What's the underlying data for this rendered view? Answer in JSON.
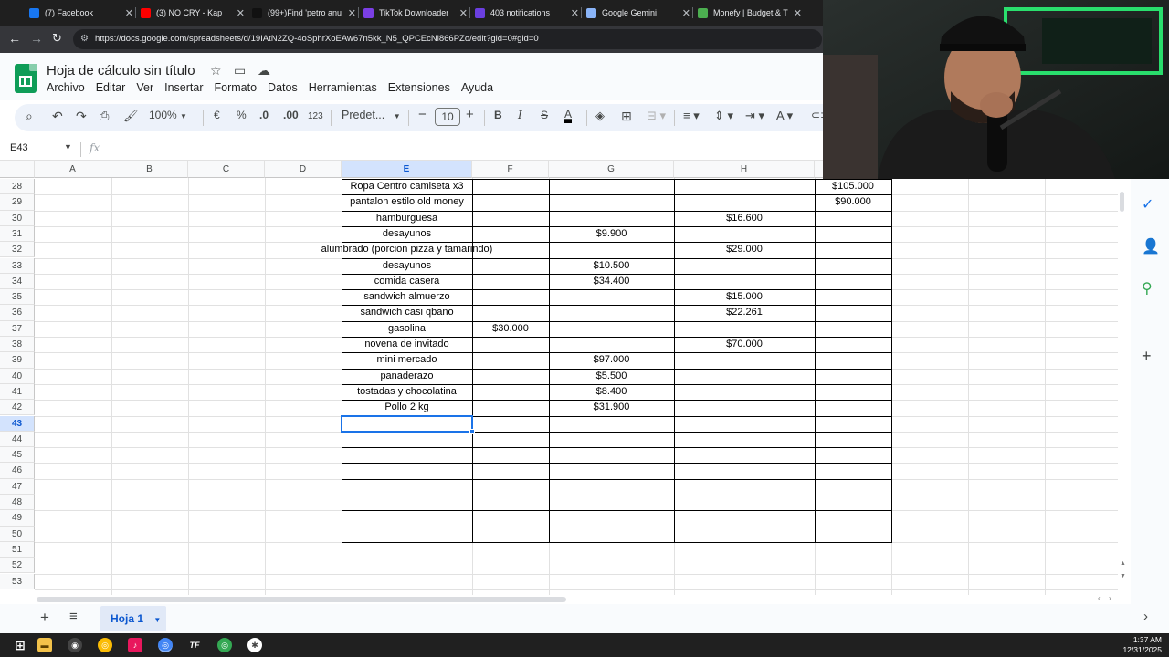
{
  "browser": {
    "tabs": [
      {
        "title": "(7) Facebook",
        "icon": "facebook-icon",
        "color": "#1877f2"
      },
      {
        "title": "(3) NO CRY - Kap",
        "icon": "youtube-icon",
        "color": "#ff0000"
      },
      {
        "title": "(99+)Find 'petro anu",
        "icon": "tiktok-icon",
        "color": "#111111"
      },
      {
        "title": "TikTok Downloader",
        "icon": "downloader-icon",
        "color": "#7b3fe4"
      },
      {
        "title": "403 notifications",
        "icon": "notifications-icon",
        "color": "#6b3fe0"
      },
      {
        "title": "Google Gemini",
        "icon": "gemini-icon",
        "color": "#8ab4f8"
      },
      {
        "title": "Monefy | Budget & T",
        "icon": "monefy-icon",
        "color": "#4caf50"
      }
    ],
    "url": "https://docs.google.com/spreadsheets/d/19IAtN2ZQ-4oSphrXoEAw67n5kk_N5_QPCEcNi866PZo/edit?gid=0#gid=0"
  },
  "doc": {
    "title": "Hoja de cálculo sin título",
    "menu": [
      "Archivo",
      "Editar",
      "Ver",
      "Insertar",
      "Formato",
      "Datos",
      "Herramientas",
      "Extensiones",
      "Ayuda"
    ]
  },
  "toolbar": {
    "zoom": "100%",
    "currency": "€",
    "percent": "%",
    "dec_decrease": ".0",
    "dec_increase": ".00",
    "format_123": "123",
    "font": "Predet...",
    "font_size": "10"
  },
  "formula": {
    "name_box": "E43",
    "fx": "fx"
  },
  "columns": [
    "A",
    "B",
    "C",
    "D",
    "E",
    "F",
    "G",
    "H"
  ],
  "rows": [
    {
      "n": "28",
      "e": "Ropa Centro camiseta x3",
      "f": "",
      "g": "",
      "h": "",
      "i": "$105.000"
    },
    {
      "n": "29",
      "e": "pantalon estilo old money",
      "f": "",
      "g": "",
      "h": "",
      "i": "$90.000"
    },
    {
      "n": "30",
      "e": "hamburguesa",
      "f": "",
      "g": "",
      "h": "$16.600",
      "i": ""
    },
    {
      "n": "31",
      "e": "desayunos",
      "f": "",
      "g": "$9.900",
      "h": "",
      "i": ""
    },
    {
      "n": "32",
      "e": "alumbrado (porcion pizza y tamarindo)",
      "f": "",
      "g": "",
      "h": "$29.000",
      "i": ""
    },
    {
      "n": "33",
      "e": "desayunos",
      "f": "",
      "g": "$10.500",
      "h": "",
      "i": ""
    },
    {
      "n": "34",
      "e": "comida casera",
      "f": "",
      "g": "$34.400",
      "h": "",
      "i": ""
    },
    {
      "n": "35",
      "e": "sandwich almuerzo",
      "f": "",
      "g": "",
      "h": "$15.000",
      "i": ""
    },
    {
      "n": "36",
      "e": "sandwich casi qbano",
      "f": "",
      "g": "",
      "h": "$22.261",
      "i": ""
    },
    {
      "n": "37",
      "e": "gasolina",
      "f": "$30.000",
      "g": "",
      "h": "",
      "i": ""
    },
    {
      "n": "38",
      "e": "novena de invitado",
      "f": "",
      "g": "",
      "h": "$70.000",
      "i": ""
    },
    {
      "n": "39",
      "e": "mini mercado",
      "f": "",
      "g": "$97.000",
      "h": "",
      "i": ""
    },
    {
      "n": "40",
      "e": "panaderazo",
      "f": "",
      "g": "$5.500",
      "h": "",
      "i": ""
    },
    {
      "n": "41",
      "e": "tostadas y chocolatina",
      "f": "",
      "g": "$8.400",
      "h": "",
      "i": ""
    },
    {
      "n": "42",
      "e": "Pollo 2 kg",
      "f": "",
      "g": "$31.900",
      "h": "",
      "i": ""
    },
    {
      "n": "43",
      "e": "",
      "f": "",
      "g": "",
      "h": "",
      "i": ""
    },
    {
      "n": "44",
      "e": "",
      "f": "",
      "g": "",
      "h": "",
      "i": ""
    },
    {
      "n": "45",
      "e": "",
      "f": "",
      "g": "",
      "h": "",
      "i": ""
    },
    {
      "n": "46",
      "e": "",
      "f": "",
      "g": "",
      "h": "",
      "i": ""
    },
    {
      "n": "47",
      "e": "",
      "f": "",
      "g": "",
      "h": "",
      "i": ""
    },
    {
      "n": "48",
      "e": "",
      "f": "",
      "g": "",
      "h": "",
      "i": ""
    },
    {
      "n": "49",
      "e": "",
      "f": "",
      "g": "",
      "h": "",
      "i": ""
    },
    {
      "n": "50",
      "e": "",
      "f": "",
      "g": "",
      "h": "",
      "i": ""
    },
    {
      "n": "51",
      "e": "",
      "f": "",
      "g": "",
      "h": "",
      "i": ""
    },
    {
      "n": "52",
      "e": "",
      "f": "",
      "g": "",
      "h": "",
      "i": ""
    },
    {
      "n": "53",
      "e": "",
      "f": "",
      "g": "",
      "h": "",
      "i": ""
    }
  ],
  "selected_row": "43",
  "selected_col": "E",
  "sheet_tab": "Hoja 1",
  "clock": {
    "time": "1:37 AM",
    "date": "12/31/2025"
  },
  "colors": {
    "accent": "#1a73e8",
    "sheets_green": "#0f9d58"
  }
}
